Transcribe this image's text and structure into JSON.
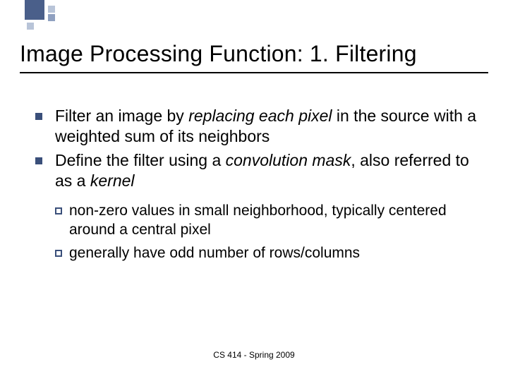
{
  "title": "Image Processing Function: 1. Filtering",
  "bullets": [
    {
      "pre": "Filter an image by ",
      "em": "replacing each pixel",
      "post": " in the source with a weighted sum of its neighbors"
    },
    {
      "pre": "Define the filter using a ",
      "em": "convolution mask",
      "post": ", also referred to as a ",
      "em2": "kernel"
    }
  ],
  "subbullets": [
    "non-zero values in small neighborhood, typically centered around a central pixel",
    "generally have odd number of rows/columns"
  ],
  "footer": "CS 414 - Spring 2009"
}
